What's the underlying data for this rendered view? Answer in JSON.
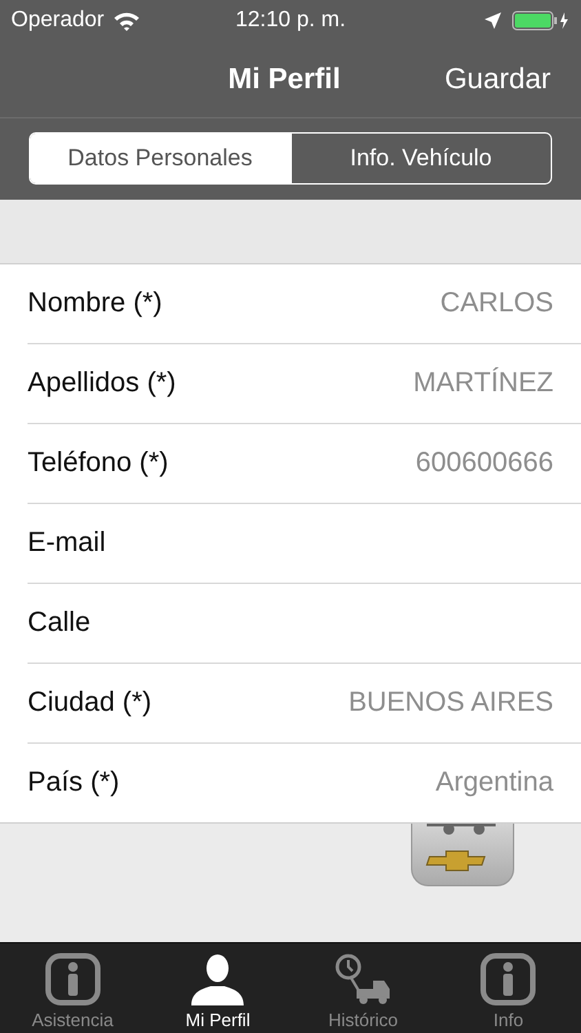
{
  "status_bar": {
    "carrier": "Operador",
    "time": "12:10 p. m."
  },
  "nav_bar": {
    "title": "Mi Perfil",
    "action": "Guardar"
  },
  "segments": [
    {
      "label": "Datos Personales",
      "selected": true
    },
    {
      "label": "Info. Vehículo",
      "selected": false
    }
  ],
  "fields": [
    {
      "label": "Nombre (*)",
      "value": "CARLOS"
    },
    {
      "label": "Apellidos (*)",
      "value": "MARTÍNEZ"
    },
    {
      "label": "Teléfono (*)",
      "value": "600600666"
    },
    {
      "label": "E-mail"
    },
    {
      "label": "Calle"
    },
    {
      "label": "Ciudad (*)",
      "value": "BUENOS AIRES"
    },
    {
      "label": "País (*)",
      "value": "Argentina"
    }
  ],
  "tabs": [
    {
      "label": "Asistencia",
      "kind": "info",
      "selected": false
    },
    {
      "label": "Mi Perfil",
      "kind": "person",
      "selected": true
    },
    {
      "label": "Histórico",
      "kind": "truck",
      "selected": false
    },
    {
      "label": "Info",
      "kind": "info",
      "selected": false
    }
  ]
}
